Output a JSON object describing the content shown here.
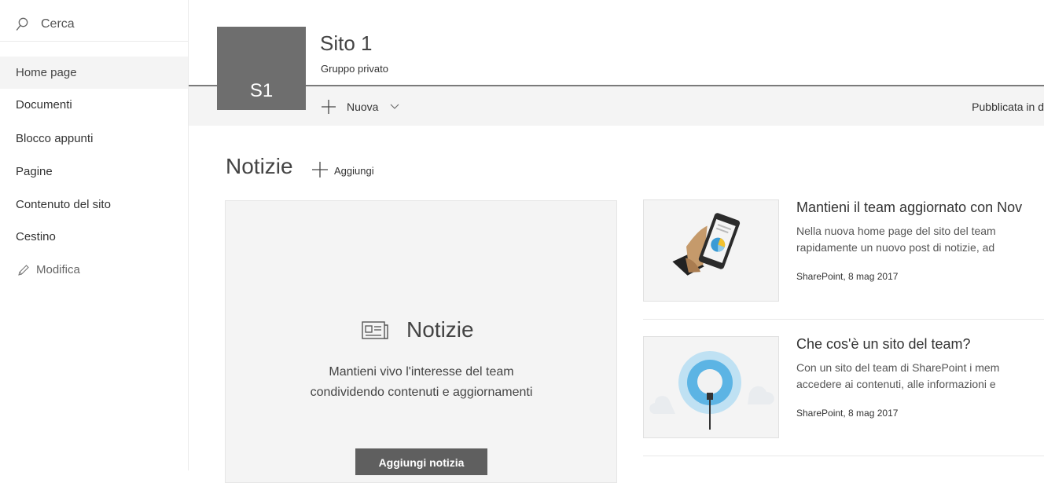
{
  "sidebar": {
    "search_placeholder": "Cerca",
    "items": [
      {
        "label": "Home page",
        "active": true
      },
      {
        "label": "Documenti"
      },
      {
        "label": "Blocco appunti"
      },
      {
        "label": "Pagine"
      },
      {
        "label": "Contenuto del sito"
      },
      {
        "label": "Cestino"
      }
    ],
    "edit_label": "Modifica"
  },
  "header": {
    "logo_initials": "S1",
    "logo_color": "#6e6e6e",
    "title": "Sito 1",
    "subtitle": "Gruppo privato"
  },
  "commandbar": {
    "new_label": "Nuova",
    "published_label": "Pubblicata in d"
  },
  "news": {
    "heading": "Notizie",
    "add_label": "Aggiungi",
    "placeholder": {
      "title": "Notizie",
      "description": "Mantieni vivo l'interesse del team condividendo contenuti e aggiornamenti",
      "button_label": "Aggiungi notizia",
      "button_color": "#5f5f5f"
    },
    "items": [
      {
        "title": "Mantieni il team aggiornato con Nov",
        "excerpt_line1": "Nella nuova home page del sito del team",
        "excerpt_line2": "rapidamente un nuovo post di notizie, ad",
        "meta": "SharePoint, 8 mag 2017",
        "thumb_icon": "phone-chart-icon"
      },
      {
        "title": "Che cos'è un sito del team?",
        "excerpt_line1": "Con un sito del team di SharePoint i mem",
        "excerpt_line2": "accedere ai contenuti, alle informazioni e",
        "meta": "SharePoint, 8 mag 2017",
        "thumb_icon": "lightbulb-cloud-icon"
      }
    ]
  }
}
